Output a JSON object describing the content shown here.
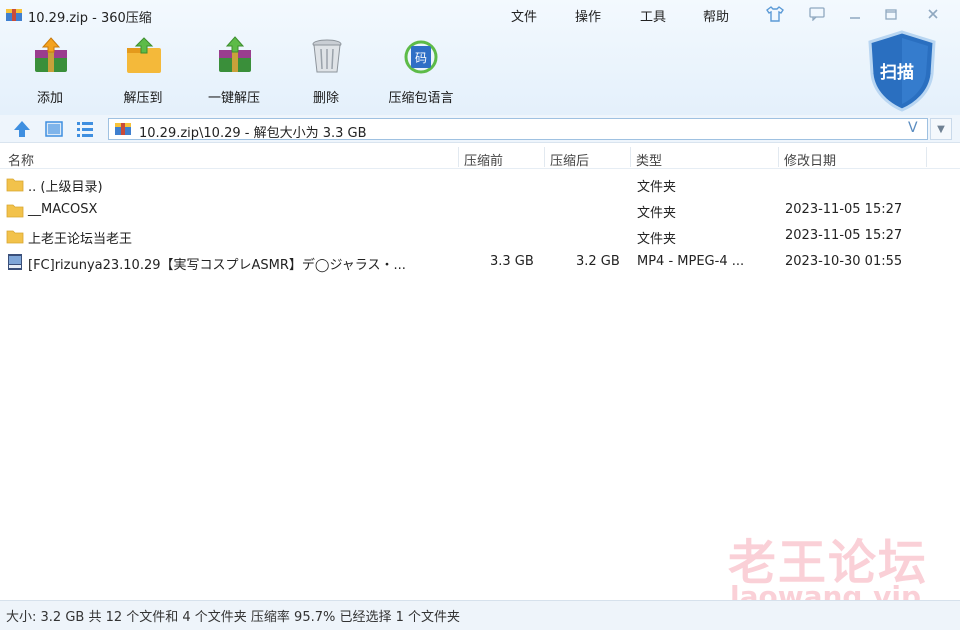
{
  "window": {
    "title": "10.29.zip - 360压缩",
    "menu": [
      "文件",
      "操作",
      "工具",
      "帮助"
    ],
    "controls": [
      "skin-icon",
      "feedback-icon",
      "minimize-icon",
      "restore-icon",
      "close-icon"
    ]
  },
  "toolbar": {
    "items": [
      {
        "label": "添加",
        "icon": "add-archive-icon"
      },
      {
        "label": "解压到",
        "icon": "extract-to-icon"
      },
      {
        "label": "一键解压",
        "icon": "one-click-extract-icon"
      },
      {
        "label": "删除",
        "icon": "delete-icon"
      },
      {
        "label": "压缩包语言",
        "icon": "archive-language-icon",
        "icon_text": "码"
      }
    ],
    "scan_label": "扫描"
  },
  "address": {
    "path": "10.29.zip\\10.29 - 解包大小为 3.3 GB",
    "v_label": "V"
  },
  "columns": {
    "name": "名称",
    "packed": "压缩前",
    "unpacked": "压缩后",
    "type": "类型",
    "modified": "修改日期"
  },
  "files": [
    {
      "name": ".. (上级目录)",
      "before": "",
      "after": "",
      "type": "文件夹",
      "date": "",
      "icon": "folder-icon"
    },
    {
      "name": "__MACOSX",
      "before": "",
      "after": "",
      "type": "文件夹",
      "date": "2023-11-05 15:27",
      "icon": "folder-icon"
    },
    {
      "name": "上老王论坛当老王",
      "before": "",
      "after": "",
      "type": "文件夹",
      "date": "2023-11-05 15:27",
      "icon": "folder-icon"
    },
    {
      "name": "[FC]rizunya23.10.29【実写コスプレASMR】デ◯ジャラス・...",
      "before": "3.3 GB",
      "after": "3.2 GB",
      "type": "MP4 - MPEG-4 ...",
      "date": "2023-10-30 01:55",
      "icon": "video-file-icon"
    }
  ],
  "status": {
    "text": "大小: 3.2 GB 共 12 个文件和 4 个文件夹 压缩率 95.7% 已经选择 1 个文件夹"
  },
  "watermark": {
    "line1": "老王论坛",
    "line2": "laowang.vip"
  },
  "colors": {
    "accent": "#1f6fc5",
    "chrome_bg": "#e6f1fb",
    "status_bg": "#eef4fa",
    "folder": "#f2c24b",
    "watermark": "#f0788c"
  }
}
